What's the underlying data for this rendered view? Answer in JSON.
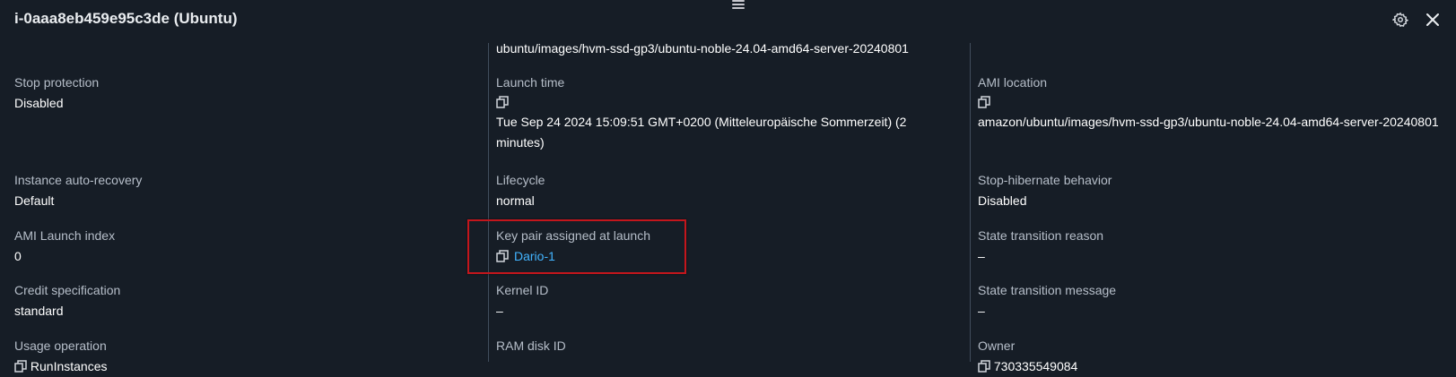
{
  "header": {
    "title": "i-0aaa8eb459e95c3de (Ubuntu)",
    "icons": [
      "drag-handle-icon",
      "gear-icon",
      "close-icon"
    ]
  },
  "columns": {
    "left": {
      "fields": [
        {
          "label": "Stop protection",
          "value": "Disabled"
        },
        {
          "label": "Instance auto-recovery",
          "value": "Default"
        },
        {
          "label": "AMI Launch index",
          "value": "0"
        },
        {
          "label": "Credit specification",
          "value": "standard"
        },
        {
          "label": "Usage operation",
          "value": "RunInstances"
        }
      ]
    },
    "middle": {
      "top_value": "ubuntu/images/hvm-ssd-gp3/ubuntu-noble-24.04-amd64-server-20240801",
      "fields": [
        {
          "label": "Launch time",
          "value": "Tue Sep 24 2024 15:09:51 GMT+0200 (Mitteleuropäische Sommerzeit) (2 minutes)"
        },
        {
          "label": "Lifecycle",
          "value": "normal"
        },
        {
          "label": "Key pair assigned at launch",
          "value": "Dario-1"
        },
        {
          "label": "Kernel ID",
          "value": "–"
        },
        {
          "label": "RAM disk ID",
          "value": ""
        }
      ]
    },
    "right": {
      "fields": [
        {
          "label": "AMI location",
          "value": "amazon/ubuntu/images/hvm-ssd-gp3/ubuntu-noble-24.04-amd64-server-20240801"
        },
        {
          "label": "Stop-hibernate behavior",
          "value": "Disabled"
        },
        {
          "label": "State transition reason",
          "value": "–"
        },
        {
          "label": "State transition message",
          "value": "–"
        },
        {
          "label": "Owner",
          "value": "730335549084"
        }
      ]
    }
  },
  "colors": {
    "background": "#161d26",
    "divider": "#414d5c",
    "label": "#b6bec9",
    "value": "#ffffff",
    "link": "#42b4ff",
    "highlight": "#c4161c"
  }
}
